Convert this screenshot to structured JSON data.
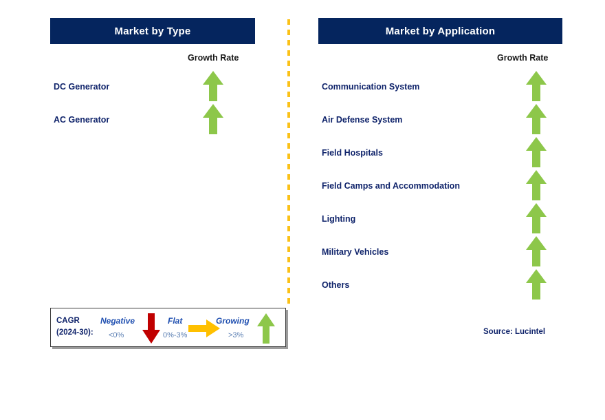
{
  "panels": {
    "left": {
      "title": "Market by Type",
      "growth_rate_label": "Growth Rate",
      "items": [
        {
          "label": "DC Generator",
          "trend": "growing"
        },
        {
          "label": "AC Generator",
          "trend": "growing"
        }
      ]
    },
    "right": {
      "title": "Market by Application",
      "growth_rate_label": "Growth Rate",
      "items": [
        {
          "label": "Communication System",
          "trend": "growing"
        },
        {
          "label": "Air Defense System",
          "trend": "growing"
        },
        {
          "label": "Field Hospitals",
          "trend": "growing"
        },
        {
          "label": "Field Camps and Accommodation",
          "trend": "growing"
        },
        {
          "label": "Lighting",
          "trend": "growing"
        },
        {
          "label": "Military Vehicles",
          "trend": "growing"
        },
        {
          "label": "Others",
          "trend": "growing"
        }
      ]
    }
  },
  "legend": {
    "cagr_line1": "CAGR",
    "cagr_line2": "(2024-30):",
    "entries": [
      {
        "term": "Negative",
        "range": "<0%",
        "icon": "arrow-down-red-icon",
        "color": "#c00000"
      },
      {
        "term": "Flat",
        "range": "0%-3%",
        "icon": "arrow-right-orange-icon",
        "color": "#ffc000"
      },
      {
        "term": "Growing",
        "range": ">3%",
        "icon": "arrow-up-green-icon",
        "color": "#8dc74a"
      }
    ]
  },
  "source": "Source: Lucintel",
  "colors": {
    "header_navy": "#05255e",
    "label_navy": "#10246b",
    "arrow_green": "#8dc74a",
    "arrow_red": "#c00000",
    "arrow_orange": "#ffc000",
    "divider_yellow": "#fbc117"
  },
  "chart_data": {
    "type": "table",
    "title": "Military Generator Market Growth Rate by Segment",
    "columns": [
      "Segment",
      "Growth Rate"
    ],
    "groups": [
      {
        "name": "Market by Type",
        "rows": [
          {
            "Segment": "DC Generator",
            "Growth Rate": "Growing (>3%)"
          },
          {
            "Segment": "AC Generator",
            "Growth Rate": "Growing (>3%)"
          }
        ]
      },
      {
        "name": "Market by Application",
        "rows": [
          {
            "Segment": "Communication System",
            "Growth Rate": "Growing (>3%)"
          },
          {
            "Segment": "Air Defense System",
            "Growth Rate": "Growing (>3%)"
          },
          {
            "Segment": "Field Hospitals",
            "Growth Rate": "Growing (>3%)"
          },
          {
            "Segment": "Field Camps and Accommodation",
            "Growth Rate": "Growing (>3%)"
          },
          {
            "Segment": "Lighting",
            "Growth Rate": "Growing (>3%)"
          },
          {
            "Segment": "Military Vehicles",
            "Growth Rate": "Growing (>3%)"
          },
          {
            "Segment": "Others",
            "Growth Rate": "Growing (>3%)"
          }
        ]
      }
    ],
    "legend": [
      {
        "label": "Negative",
        "range": "<0%"
      },
      {
        "label": "Flat",
        "range": "0%-3%"
      },
      {
        "label": "Growing",
        "range": ">3%"
      }
    ],
    "cagr_period": "2024-30"
  }
}
